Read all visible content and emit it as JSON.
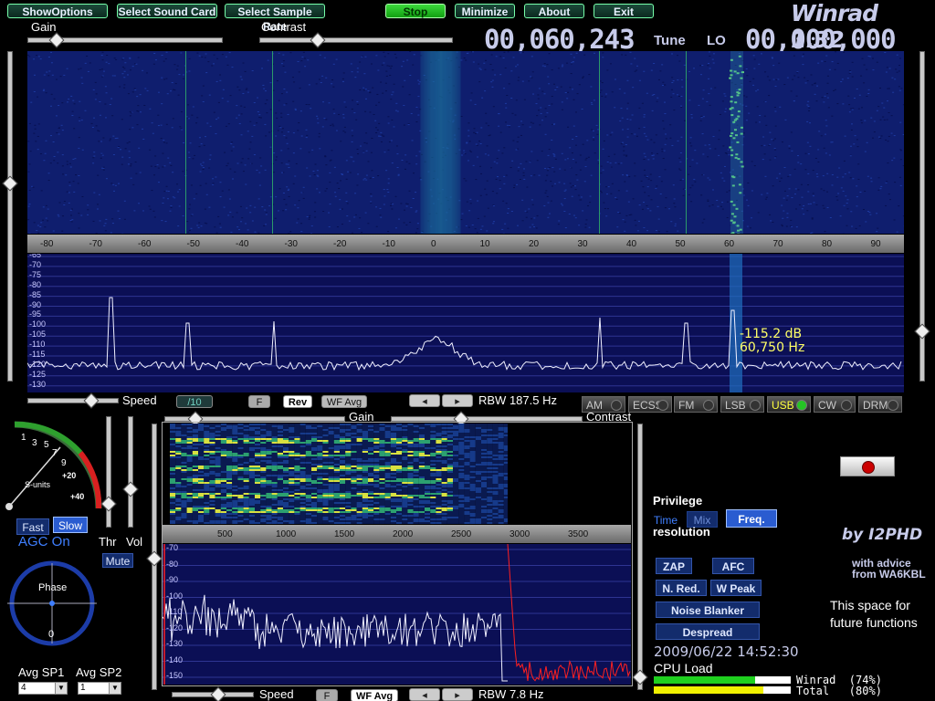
{
  "app": {
    "title": "Winrad 1.32",
    "author": "by I2PHD",
    "advice_line1": "with advice",
    "advice_line2": "from WA6KBL",
    "future_line1": "This space for",
    "future_line2": "future functions"
  },
  "toolbar": {
    "show_options": "ShowOptions",
    "select_sound_card": "Select Sound Card",
    "select_sample_rate": "Select Sample Rate",
    "stop": "Stop",
    "minimize": "Minimize",
    "about": "About",
    "exit": "Exit"
  },
  "sliders": {
    "gain": "Gain",
    "contrast": "Contrast",
    "speed": "Speed",
    "gain2": "Gain",
    "contrast2": "Contrast",
    "speed2": "Speed",
    "thr": "Thr",
    "vol": "Vol"
  },
  "freq": {
    "tune": "00,060,243",
    "tune_label": "Tune",
    "lo_label": "LO",
    "lo": "00,000,000"
  },
  "main_axis": {
    "ticks": [
      "-80",
      "-70",
      "-60",
      "-50",
      "-40",
      "-30",
      "-20",
      "-10",
      "0",
      "10",
      "20",
      "30",
      "40",
      "50",
      "60",
      "70",
      "80",
      "90"
    ],
    "db_labels": [
      "-65",
      "-70",
      "-75",
      "-80",
      "-85",
      "-90",
      "-95",
      "-100",
      "-105",
      "-110",
      "-115",
      "-120",
      "-125",
      "-130"
    ]
  },
  "readout": {
    "db": "-115.2 dB",
    "hz": "60,750 Hz"
  },
  "controls_row": {
    "div10": "/10",
    "f": "F",
    "rev": "Rev",
    "wf_avg": "WF Avg",
    "rbw": "RBW  187.5 Hz"
  },
  "modes": [
    {
      "label": "AM",
      "on": false
    },
    {
      "label": "ECSS",
      "on": false
    },
    {
      "label": "FM",
      "on": false
    },
    {
      "label": "LSB",
      "on": false
    },
    {
      "label": "USB",
      "on": true
    },
    {
      "label": "CW",
      "on": false
    },
    {
      "label": "DRM",
      "on": false
    }
  ],
  "smeter": {
    "scale": [
      "1",
      "3",
      "5",
      "7",
      "9",
      "+20",
      "+40"
    ],
    "units": "S-units"
  },
  "agc": {
    "fast": "Fast",
    "slow": "Slow",
    "status": "AGC On",
    "mute": "Mute"
  },
  "phase": {
    "label": "Phase",
    "zero": "0"
  },
  "avg": {
    "sp1_label": "Avg SP1",
    "sp1_value": "4",
    "sp2_label": "Avg SP2",
    "sp2_value": "1"
  },
  "audio_axis": {
    "ticks": [
      "500",
      "1000",
      "1500",
      "2000",
      "2500",
      "3000",
      "3500"
    ],
    "db_labels": [
      "-70",
      "-80",
      "-90",
      "-100",
      "-110",
      "-120",
      "-130",
      "-140",
      "-150"
    ]
  },
  "audio_row": {
    "f": "F",
    "wf_avg": "WF Avg",
    "rbw": "RBW  7.8 Hz"
  },
  "privilege": {
    "title": "Privilege",
    "time": "Time",
    "mix": "Mix",
    "freq": "Freq.",
    "resolution": "resolution"
  },
  "dsp": {
    "zap": "ZAP",
    "afc": "AFC",
    "nred": "N. Red.",
    "wpeak": "W Peak",
    "nb": "Noise Blanker",
    "despread": "Despread"
  },
  "status": {
    "datetime": "2009/06/22 14:52:30",
    "cpu_label": "CPU Load",
    "winrad_load": "Winrad  (74%)",
    "total_load": "Total   (80%)",
    "winrad_pct": 74,
    "total_pct": 80
  },
  "colors": {
    "accent_green": "#25c525",
    "usb_yellow": "#ffff40",
    "spectrum_bg": "#0b0f55",
    "title": "#c7cbea"
  }
}
